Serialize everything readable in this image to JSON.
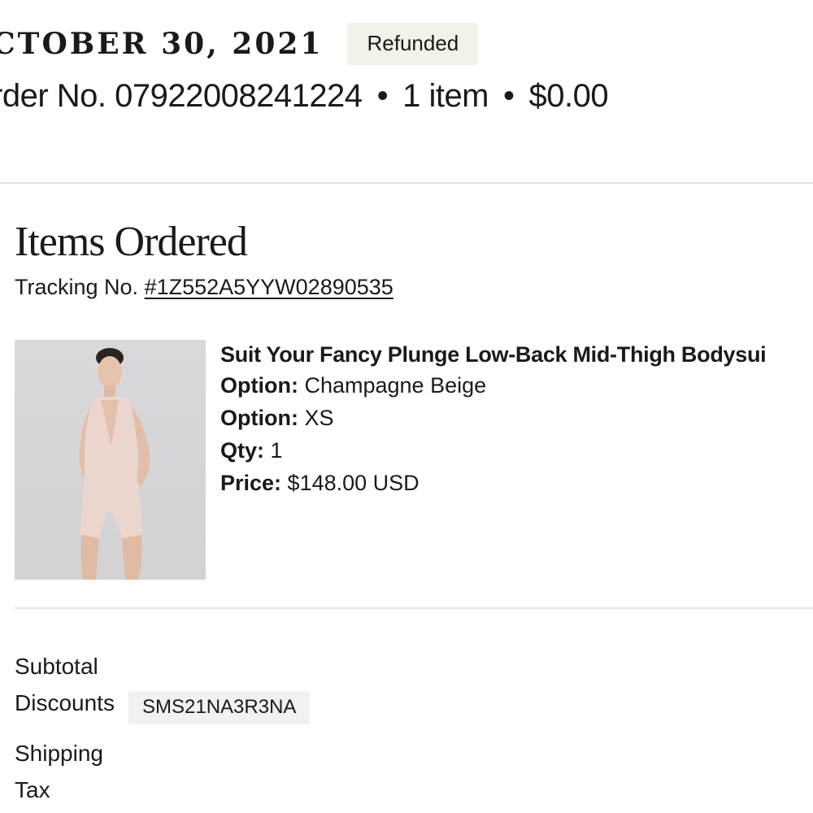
{
  "order": {
    "date": "CTOBER 30, 2021",
    "status": "Refunded",
    "number_label": "rder No. 07922008241224",
    "separator": "•",
    "item_count": "1 item",
    "total": "$0.00"
  },
  "items_section": {
    "title": "Items Ordered",
    "tracking_label": "Tracking No. ",
    "tracking_number": "#1Z552A5YYW02890535"
  },
  "item": {
    "name": "Suit Your Fancy Plunge Low-Back Mid-Thigh Bodysui",
    "image_alt": "product-photo",
    "details": [
      {
        "label": "Option:",
        "value": " Champagne Beige"
      },
      {
        "label": "Option:",
        "value": " XS"
      },
      {
        "label": "Qty:",
        "value": " 1"
      },
      {
        "label": "Price:",
        "value": " $148.00 USD"
      }
    ]
  },
  "summary": {
    "subtotal_label": "Subtotal",
    "discounts_label": "Discounts",
    "discount_code": "SMS21NA3R3NA",
    "shipping_label": "Shipping",
    "tax_label": "Tax"
  },
  "colors": {
    "badge_bg": "#f4f0ea",
    "divider": "#e2e2e2",
    "code_bg": "#f1f1f1"
  }
}
